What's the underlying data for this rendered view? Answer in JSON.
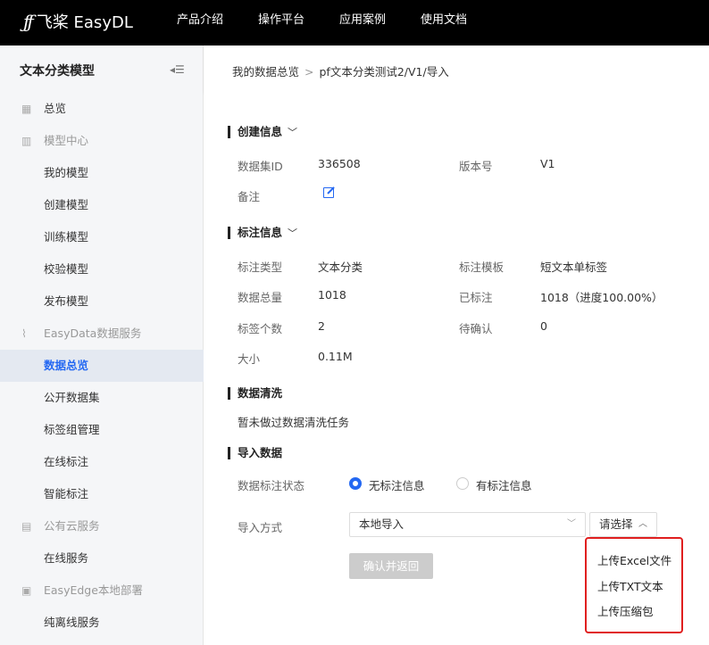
{
  "topbar": {
    "logo_mark": "ƒƒ",
    "logo_text": "飞桨 EasyDL",
    "nav": [
      "产品介绍",
      "操作平台",
      "应用案例",
      "使用文档"
    ]
  },
  "sidebar": {
    "title": "文本分类模型",
    "collapse_icon": "collapse-menu-icon",
    "items": [
      {
        "label": "总览",
        "icon": "grid-icon"
      },
      {
        "label": "模型中心",
        "icon": "building-icon"
      },
      {
        "label": "我的模型"
      },
      {
        "label": "创建模型"
      },
      {
        "label": "训练模型"
      },
      {
        "label": "校验模型"
      },
      {
        "label": "发布模型"
      },
      {
        "label": "EasyData数据服务",
        "icon": "chart-icon"
      },
      {
        "label": "数据总览"
      },
      {
        "label": "公开数据集"
      },
      {
        "label": "标签组管理"
      },
      {
        "label": "在线标注"
      },
      {
        "label": "智能标注"
      },
      {
        "label": "公有云服务",
        "icon": "server-icon"
      },
      {
        "label": "在线服务"
      },
      {
        "label": "EasyEdge本地部署",
        "icon": "chip-icon"
      },
      {
        "label": "纯离线服务"
      }
    ]
  },
  "breadcrumb": {
    "root": "我的数据总览",
    "sep": ">",
    "current": "pf文本分类测试2/V1/导入"
  },
  "create_info": {
    "title": "创建信息",
    "dataset_id_label": "数据集ID",
    "dataset_id": "336508",
    "version_label": "版本号",
    "version": "V1",
    "note_label": "备注"
  },
  "label_info": {
    "title": "标注信息",
    "type_label": "标注类型",
    "type": "文本分类",
    "template_label": "标注模板",
    "template": "短文本单标签",
    "total_label": "数据总量",
    "total": "1018",
    "labeled_label": "已标注",
    "labeled": "1018（进度100.00%）",
    "tags_label": "标签个数",
    "tags": "2",
    "pending_label": "待确认",
    "pending": "0",
    "size_label": "大小",
    "size": "0.11M"
  },
  "cleaning": {
    "title": "数据清洗",
    "text": "暂未做过数据清洗任务"
  },
  "import": {
    "title": "导入数据",
    "status_label": "数据标注状态",
    "option_unlabeled": "无标注信息",
    "option_labeled": "有标注信息",
    "method_label": "导入方式",
    "method_value": "本地导入",
    "choose_value": "请选择",
    "confirm_label": "确认并返回",
    "dropdown": [
      "上传Excel文件",
      "上传TXT文本",
      "上传压缩包"
    ]
  },
  "colors": {
    "accent": "#2468f2",
    "highlight_border": "#e01f1f"
  }
}
